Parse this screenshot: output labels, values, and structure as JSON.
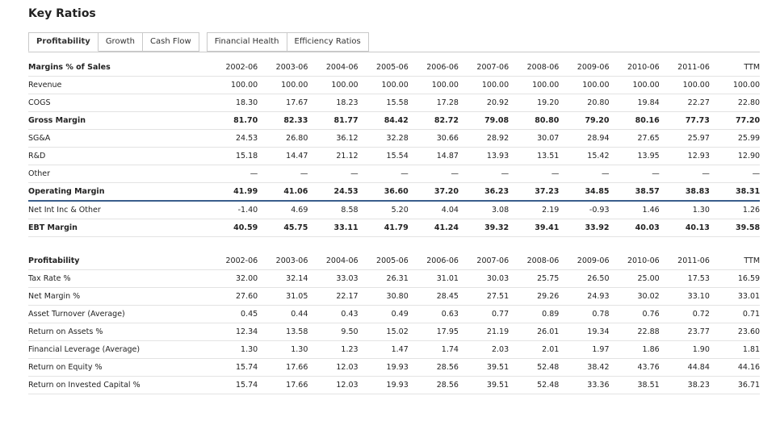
{
  "title": "Key Ratios",
  "tabs": [
    "Profitability",
    "Growth",
    "Cash Flow",
    "Financial Health",
    "Efficiency Ratios"
  ],
  "active_tab": "Profitability",
  "margins": {
    "header": "Margins % of Sales",
    "columns": [
      "2002-06",
      "2003-06",
      "2004-06",
      "2005-06",
      "2006-06",
      "2007-06",
      "2008-06",
      "2009-06",
      "2010-06",
      "2011-06",
      "TTM"
    ],
    "rows": [
      {
        "label": "Revenue",
        "bold": false,
        "values": [
          "100.00",
          "100.00",
          "100.00",
          "100.00",
          "100.00",
          "100.00",
          "100.00",
          "100.00",
          "100.00",
          "100.00",
          "100.00"
        ]
      },
      {
        "label": "COGS",
        "bold": false,
        "values": [
          "18.30",
          "17.67",
          "18.23",
          "15.58",
          "17.28",
          "20.92",
          "19.20",
          "20.80",
          "19.84",
          "22.27",
          "22.80"
        ]
      },
      {
        "label": "Gross Margin",
        "bold": true,
        "values": [
          "81.70",
          "82.33",
          "81.77",
          "84.42",
          "82.72",
          "79.08",
          "80.80",
          "79.20",
          "80.16",
          "77.73",
          "77.20"
        ]
      },
      {
        "label": "SG&A",
        "bold": false,
        "values": [
          "24.53",
          "26.80",
          "36.12",
          "32.28",
          "30.66",
          "28.92",
          "30.07",
          "28.94",
          "27.65",
          "25.97",
          "25.99"
        ]
      },
      {
        "label": "R&D",
        "bold": false,
        "values": [
          "15.18",
          "14.47",
          "21.12",
          "15.54",
          "14.87",
          "13.93",
          "13.51",
          "15.42",
          "13.95",
          "12.93",
          "12.90"
        ]
      },
      {
        "label": "Other",
        "bold": false,
        "values": [
          "—",
          "—",
          "—",
          "—",
          "—",
          "—",
          "—",
          "—",
          "—",
          "—",
          "—"
        ]
      },
      {
        "label": "Operating Margin",
        "bold": true,
        "values": [
          "41.99",
          "41.06",
          "24.53",
          "36.60",
          "37.20",
          "36.23",
          "37.23",
          "34.85",
          "38.57",
          "38.83",
          "38.31"
        ]
      },
      {
        "label": "Net Int Inc & Other",
        "bold": false,
        "values": [
          "-1.40",
          "4.69",
          "8.58",
          "5.20",
          "4.04",
          "3.08",
          "2.19",
          "-0.93",
          "1.46",
          "1.30",
          "1.26"
        ]
      },
      {
        "label": "EBT Margin",
        "bold": true,
        "values": [
          "40.59",
          "45.75",
          "33.11",
          "41.79",
          "41.24",
          "39.32",
          "39.41",
          "33.92",
          "40.03",
          "40.13",
          "39.58"
        ]
      }
    ]
  },
  "profitability": {
    "header": "Profitability",
    "columns": [
      "2002-06",
      "2003-06",
      "2004-06",
      "2005-06",
      "2006-06",
      "2007-06",
      "2008-06",
      "2009-06",
      "2010-06",
      "2011-06",
      "TTM"
    ],
    "rows": [
      {
        "label": "Tax Rate %",
        "values": [
          "32.00",
          "32.14",
          "33.03",
          "26.31",
          "31.01",
          "30.03",
          "25.75",
          "26.50",
          "25.00",
          "17.53",
          "16.59"
        ]
      },
      {
        "label": "Net Margin %",
        "values": [
          "27.60",
          "31.05",
          "22.17",
          "30.80",
          "28.45",
          "27.51",
          "29.26",
          "24.93",
          "30.02",
          "33.10",
          "33.01"
        ]
      },
      {
        "label": "Asset Turnover (Average)",
        "values": [
          "0.45",
          "0.44",
          "0.43",
          "0.49",
          "0.63",
          "0.77",
          "0.89",
          "0.78",
          "0.76",
          "0.72",
          "0.71"
        ]
      },
      {
        "label": "Return on Assets %",
        "values": [
          "12.34",
          "13.58",
          "9.50",
          "15.02",
          "17.95",
          "21.19",
          "26.01",
          "19.34",
          "22.88",
          "23.77",
          "23.60"
        ]
      },
      {
        "label": "Financial Leverage (Average)",
        "values": [
          "1.30",
          "1.30",
          "1.23",
          "1.47",
          "1.74",
          "2.03",
          "2.01",
          "1.97",
          "1.86",
          "1.90",
          "1.81"
        ]
      },
      {
        "label": "Return on Equity %",
        "values": [
          "15.74",
          "17.66",
          "12.03",
          "19.93",
          "28.56",
          "39.51",
          "52.48",
          "38.42",
          "43.76",
          "44.84",
          "44.16"
        ]
      },
      {
        "label": "Return on Invested Capital %",
        "values": [
          "15.74",
          "17.66",
          "12.03",
          "19.93",
          "28.56",
          "39.51",
          "52.48",
          "33.36",
          "38.51",
          "38.23",
          "36.71"
        ]
      }
    ]
  }
}
